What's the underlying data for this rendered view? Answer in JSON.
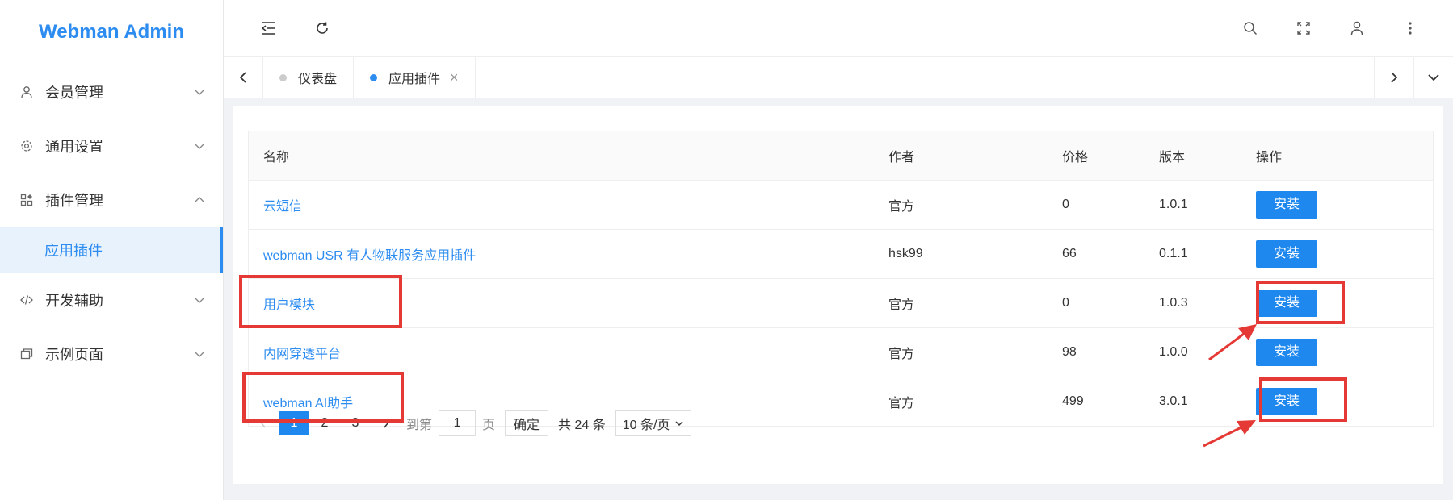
{
  "brand": "Webman Admin",
  "sidebar": {
    "items": [
      {
        "label": "会员管理",
        "icon": "user-icon"
      },
      {
        "label": "通用设置",
        "icon": "gear-icon"
      },
      {
        "label": "插件管理",
        "icon": "plugin-icon",
        "expanded": true
      },
      {
        "label": "应用插件",
        "icon": "",
        "sub": true,
        "active": true
      },
      {
        "label": "开发辅助",
        "icon": "code-icon"
      },
      {
        "label": "示例页面",
        "icon": "page-icon"
      }
    ]
  },
  "tabs": [
    {
      "label": "仪表盘",
      "active": false
    },
    {
      "label": "应用插件",
      "active": true,
      "close": "×"
    }
  ],
  "table": {
    "headers": {
      "name": "名称",
      "author": "作者",
      "price": "价格",
      "version": "版本",
      "op": "操作"
    },
    "rows": [
      {
        "name": "云短信",
        "author": "官方",
        "price": "0",
        "version": "1.0.1",
        "action": "安装"
      },
      {
        "name": "webman USR 有人物联服务应用插件",
        "author": "hsk99",
        "price": "66",
        "version": "0.1.1",
        "action": "安装"
      },
      {
        "name": "用户模块",
        "author": "官方",
        "price": "0",
        "version": "1.0.3",
        "action": "安装"
      },
      {
        "name": "内网穿透平台",
        "author": "官方",
        "price": "98",
        "version": "1.0.0",
        "action": "安装"
      },
      {
        "name": "webman AI助手",
        "author": "官方",
        "price": "499",
        "version": "3.0.1",
        "action": "安装"
      }
    ]
  },
  "pagination": {
    "pages": [
      "1",
      "2",
      "3"
    ],
    "current": "1",
    "goto_label": "到第",
    "goto_value": "1",
    "page_unit": "页",
    "confirm": "确定",
    "total": "共 24 条",
    "page_size": "10 条/页"
  },
  "colors": {
    "accent": "#2d8cf0",
    "button": "#1e88ef",
    "annotation": "#e53935"
  }
}
